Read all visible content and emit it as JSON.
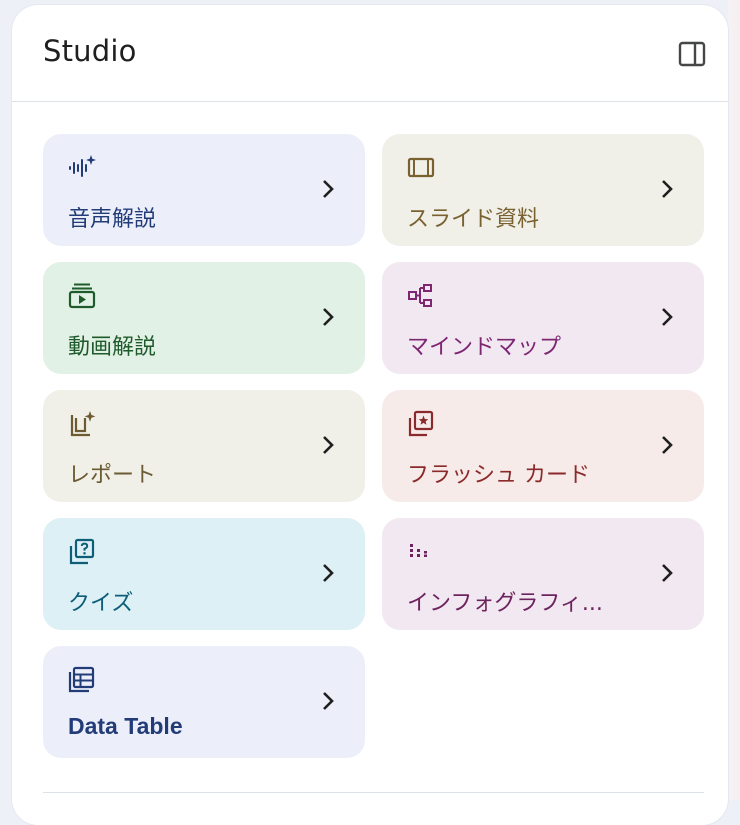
{
  "panel": {
    "title": "Studio",
    "toggle_icon": "side-panel-icon"
  },
  "tiles": [
    {
      "id": "audio-overview",
      "label": "音声解説",
      "icon": "audio-sparkle-icon",
      "bg": "#eceffa",
      "fg": "#223c78"
    },
    {
      "id": "slide-deck",
      "label": "スライド資料",
      "icon": "slides-icon",
      "bg": "#f0f0e8",
      "fg": "#7a6230"
    },
    {
      "id": "video-overview",
      "label": "動画解説",
      "icon": "video-icon",
      "bg": "#e2f1e5",
      "fg": "#1f5a2c"
    },
    {
      "id": "mind-map",
      "label": "マインドマップ",
      "icon": "mind-map-icon",
      "bg": "#f1e8f1",
      "fg": "#7e2673"
    },
    {
      "id": "report",
      "label": "レポート",
      "icon": "report-icon",
      "bg": "#f0f0e8",
      "fg": "#6b5a32"
    },
    {
      "id": "flashcards",
      "label": "フラッシュ カード",
      "icon": "flashcard-icon",
      "bg": "#f7ebea",
      "fg": "#8a2a2a"
    },
    {
      "id": "quiz",
      "label": "クイズ",
      "icon": "quiz-icon",
      "bg": "#dcf0f6",
      "fg": "#0e5e77"
    },
    {
      "id": "infographic",
      "label": "インフォグラフィ...",
      "icon": "infographic-icon",
      "bg": "#f1e8f1",
      "fg": "#6e235e"
    },
    {
      "id": "data-table",
      "label": "Data Table",
      "icon": "table-icon",
      "bg": "#eceffa",
      "fg": "#223c78"
    }
  ]
}
